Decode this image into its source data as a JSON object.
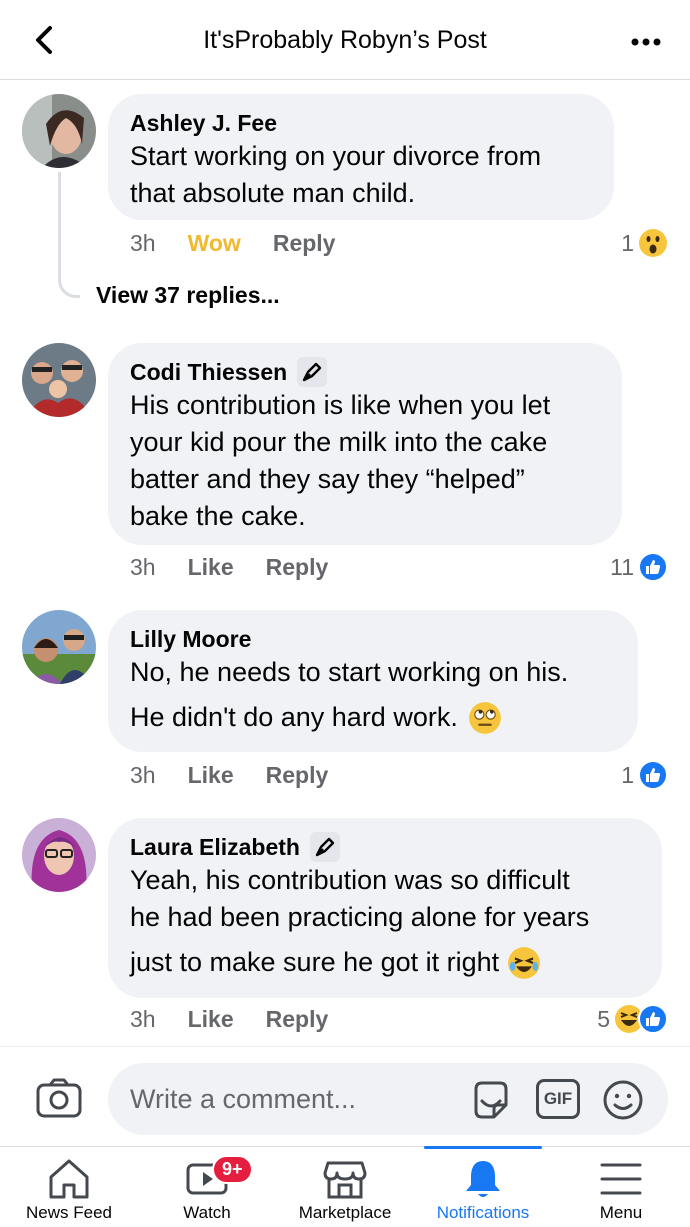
{
  "header": {
    "title": "It'sProbably Robyn’s Post"
  },
  "comments": [
    {
      "author": "Ashley J. Fee",
      "text_lines": [
        "Start working on your divorce from",
        "that absolute man child."
      ],
      "time": "3h",
      "reaction_action": "Wow",
      "reply": "Reply",
      "react_count": "1",
      "react_emoji": "wow-emoji",
      "view_replies": "View 37 replies..."
    },
    {
      "author": "Codi Thiessen",
      "text_lines": [
        "His contribution is like when you let",
        "your kid pour the milk into the cake",
        "batter and they say they “helped”",
        "bake the cake."
      ],
      "time": "3h",
      "reaction_action": "Like",
      "reply": "Reply",
      "react_count": "11"
    },
    {
      "author": "Lilly Moore",
      "text_lines": [
        "No, he needs to start working on his.",
        "He didn't do any hard work."
      ],
      "time": "3h",
      "reaction_action": "Like",
      "reply": "Reply",
      "react_count": "1"
    },
    {
      "author": "Laura Elizabeth",
      "text_lines": [
        "Yeah, his contribution was so difficult",
        "he had been practicing alone for years",
        "just to make sure he got it right"
      ],
      "time": "3h",
      "reaction_action": "Like",
      "reply": "Reply",
      "react_count": "5"
    }
  ],
  "composer": {
    "placeholder": "Write a comment...",
    "gif_label": "GIF"
  },
  "tabbar": {
    "items": [
      {
        "label": "News Feed"
      },
      {
        "label": "Watch",
        "badge": "9+"
      },
      {
        "label": "Marketplace"
      },
      {
        "label": "Notifications",
        "active": true
      },
      {
        "label": "Menu"
      }
    ]
  },
  "colors": {
    "accent": "#1877f2",
    "wow": "#f0b930",
    "badge": "#e41e3f",
    "bubble": "#f0f2f5",
    "secondary_text": "#65676b"
  }
}
